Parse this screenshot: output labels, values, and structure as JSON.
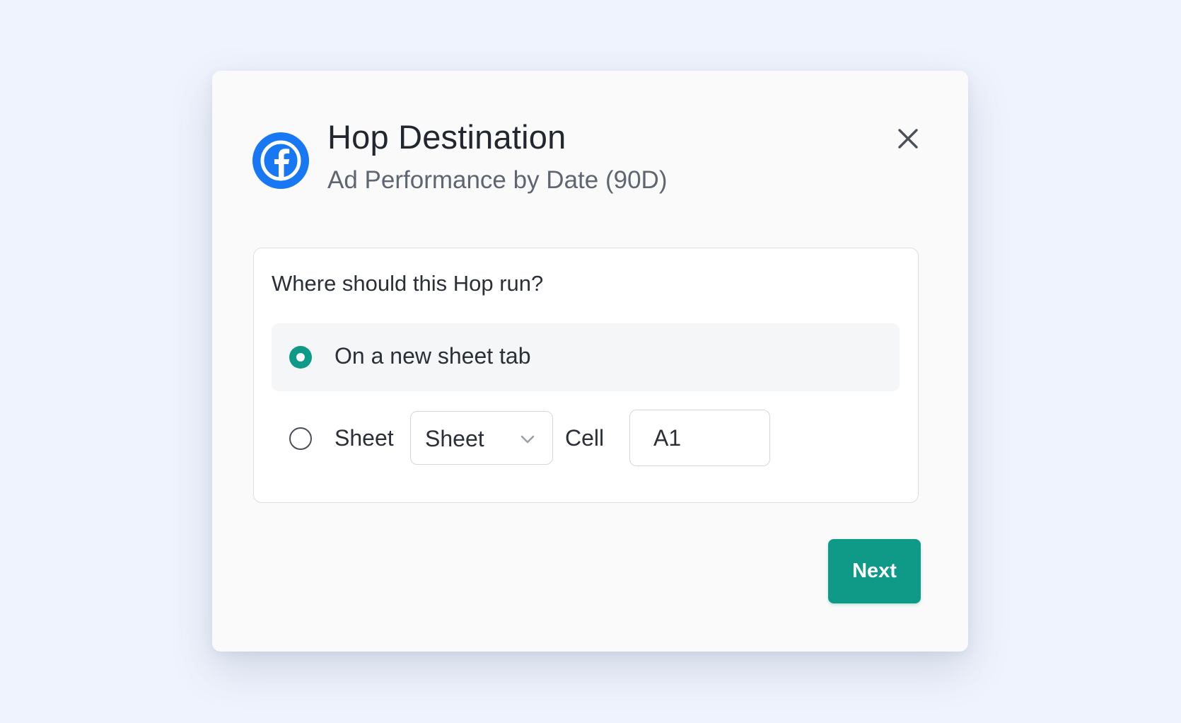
{
  "modal": {
    "title": "Hop Destination",
    "subtitle": "Ad Performance by Date (90D)",
    "logo_icon": "facebook-icon",
    "close_icon": "close-icon"
  },
  "form": {
    "question": "Where should this Hop run?",
    "options": [
      {
        "label": "On a new sheet tab",
        "selected": true
      },
      {
        "label": "Sheet",
        "selected": false
      }
    ],
    "sheet_select": {
      "value": "Sheet",
      "icon": "chevron-down-icon"
    },
    "cell_label": "Cell",
    "cell_value": "A1"
  },
  "footer": {
    "next_label": "Next"
  },
  "colors": {
    "accent": "#0e9a86",
    "facebook_blue": "#1877f2",
    "background": "#eff3fd"
  }
}
